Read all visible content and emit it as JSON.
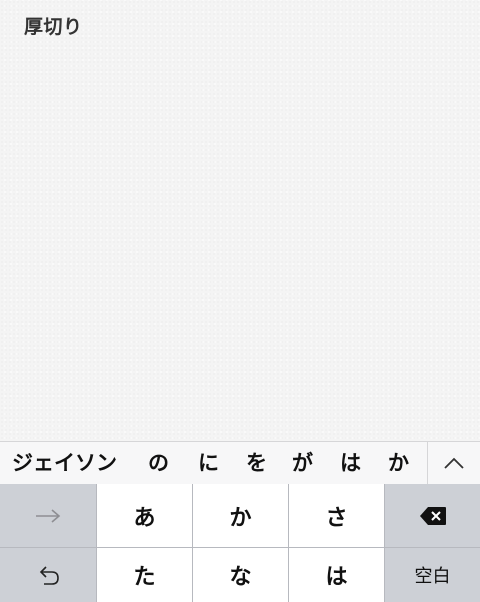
{
  "note": {
    "text": "厚切り"
  },
  "suggestions": [
    "ジェイソン",
    "の",
    "に",
    "を",
    "が",
    "は",
    "か"
  ],
  "keyboard": {
    "row1": [
      "あ",
      "か",
      "さ"
    ],
    "row2": [
      "た",
      "な",
      "は"
    ],
    "space_label": "空白",
    "icons": {
      "next": "arrow-right-icon",
      "undo": "undo-icon",
      "delete": "delete-backspace-icon",
      "expand": "chevron-up-icon"
    }
  }
}
